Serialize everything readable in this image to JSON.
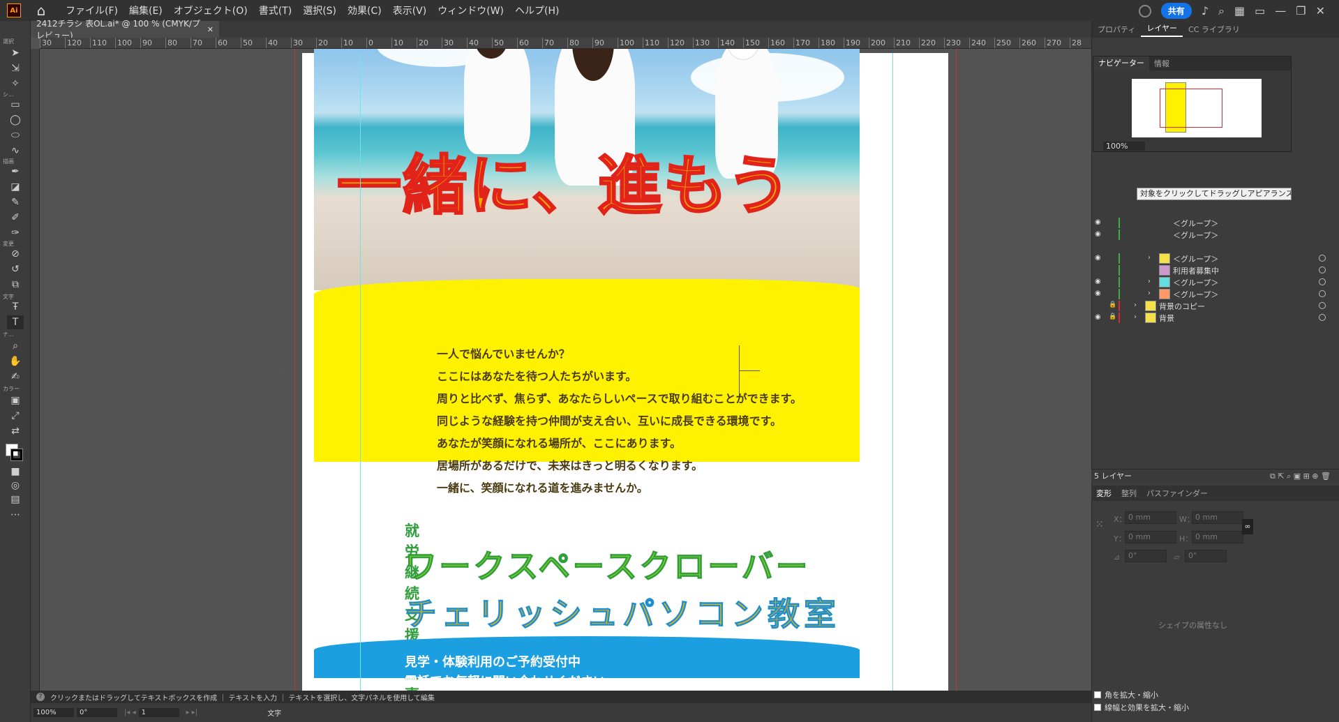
{
  "menubar": {
    "logo": "Ai",
    "items": [
      "ファイル(F)",
      "編集(E)",
      "オブジェクト(O)",
      "書式(T)",
      "選択(S)",
      "効果(C)",
      "表示(V)",
      "ウィンドウ(W)",
      "ヘルプ(H)"
    ],
    "share": "共有"
  },
  "document": {
    "tab_title": "2412チラシ 表OL.ai* @ 100 % (CMYK/プレビュー)"
  },
  "ruler": {
    "h_ticks": [
      "30",
      "120",
      "110",
      "100",
      "90",
      "80",
      "70",
      "60",
      "50",
      "40",
      "30",
      "20",
      "10",
      "0",
      "10",
      "20",
      "30",
      "40",
      "50",
      "60",
      "70",
      "80",
      "90",
      "100",
      "110",
      "120",
      "130",
      "140",
      "150",
      "160",
      "170",
      "180",
      "190",
      "200",
      "210",
      "220",
      "230",
      "240",
      "250",
      "260",
      "270",
      "28"
    ]
  },
  "toolbar": {
    "labels": [
      "選択",
      "シ...",
      "描画",
      "変更",
      "文字",
      "ナ...",
      "カラー"
    ]
  },
  "flyer": {
    "slogan": "一緒に、進もう",
    "message": [
      "一人で悩んでいませんか？",
      "ここにはあなたを待つ人たちがいます。",
      "周りと比べず、焦らず、あなたらしいペースで取り組むことができます。",
      "同じような経験を持つ仲間が支え合い、互いに成長できる環境です。",
      "あなたが笑顔になれる場所が、ここにあります。",
      "居場所があるだけで、未来はきっと明るくなります。",
      "一緒に、笑顔になれる道を進みませんか。"
    ],
    "org_type": "就労継続支援B型事業所",
    "org_name": "ワークスペースクローバー",
    "school": "チェリッシュパソコン教室",
    "contact": [
      "見学・体験利用のご予約受付中",
      "電話でお気軽に問い合わせください"
    ]
  },
  "statusbar": {
    "hint": "クリックまたはドラッグしてテキストボックスを作成 ｜ テキストを入力 ｜ テキストを選択し、文字パネルを使用して編集",
    "zoom": "100%",
    "rotate": "0°",
    "page": "1",
    "mode": "文字"
  },
  "panel": {
    "tabs": [
      "プロパティ",
      "レイヤー",
      "CC ライブラリ"
    ],
    "navigator_tabs": [
      "ナビゲーター",
      "情報"
    ],
    "navigator_zoom": "100%",
    "tooltip": "対象をクリックしてドラッグしアピアランスを移動",
    "layers": [
      {
        "name": "＜グループ＞",
        "eye": true,
        "lock": false
      },
      {
        "name": "＜グループ＞",
        "eye": true,
        "lock": false
      },
      {
        "name": "＜グループ＞",
        "eye": true,
        "lock": false
      },
      {
        "name": "利用者募集中",
        "eye": false,
        "lock": false
      },
      {
        "name": "＜グループ＞",
        "eye": true,
        "lock": false
      },
      {
        "name": "＜グループ＞",
        "eye": true,
        "lock": false
      },
      {
        "name": "背景のコピー",
        "eye": false,
        "lock": true
      },
      {
        "name": "背景",
        "eye": true,
        "lock": true
      }
    ],
    "layer_count": "5 レイヤー",
    "transform_tabs": [
      "変形",
      "整列",
      "パスファインダー"
    ],
    "fields": {
      "x_label": "X：",
      "y_label": "Y：",
      "w_label": "W：",
      "h_label": "H：",
      "x": "0 mm",
      "y": "0 mm",
      "w": "0 mm",
      "h": "0 mm",
      "angle": "0°",
      "shear": "0°"
    },
    "no_attr": "シェイプの属性なし",
    "check1": "角を拡大・縮小",
    "check2": "線幅と効果を拡大・縮小"
  }
}
